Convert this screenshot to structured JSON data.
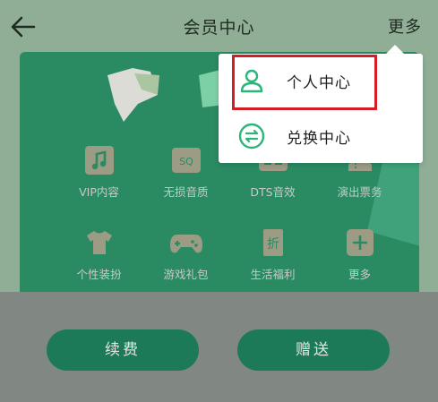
{
  "header": {
    "title": "会员中心",
    "more_label": "更多"
  },
  "benefits": {
    "row1": [
      {
        "label": "VIP内容",
        "icon": "music-note-icon"
      },
      {
        "label": "无损音质",
        "icon": "sq-icon"
      },
      {
        "label": "DTS音效",
        "icon": "dts-icon"
      },
      {
        "label": "演出票务",
        "icon": "ticket-icon"
      }
    ],
    "row2": [
      {
        "label": "个性装扮",
        "icon": "tshirt-icon"
      },
      {
        "label": "游戏礼包",
        "icon": "gamepad-icon"
      },
      {
        "label": "生活福利",
        "icon": "discount-icon"
      },
      {
        "label": "更多",
        "icon": "plus-icon"
      }
    ]
  },
  "buttons": {
    "renew": "续费",
    "gift": "赠送"
  },
  "dropdown": {
    "items": [
      {
        "label": "个人中心",
        "icon": "person-icon"
      },
      {
        "label": "兑换中心",
        "icon": "exchange-icon"
      }
    ],
    "highlight_color": "#d41e25"
  },
  "colors": {
    "accent": "#2bb57a",
    "card": "#2a8a62",
    "button": "#1d7a58"
  }
}
